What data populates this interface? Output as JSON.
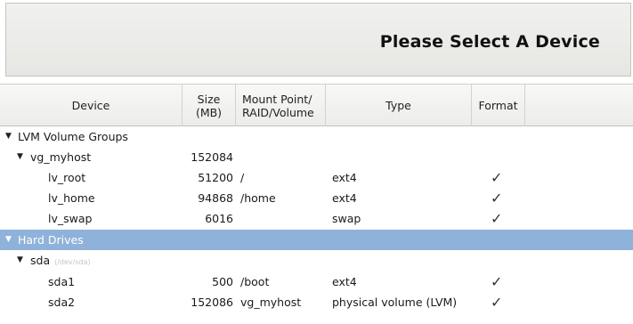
{
  "banner": {
    "title": "Please Select A Device"
  },
  "columns": {
    "device": "Device",
    "size": "Size\n(MB)",
    "mount": "Mount Point/\nRAID/Volume",
    "type": "Type",
    "format": "Format"
  },
  "rows": [
    {
      "name": "LVM Volume Groups",
      "size": "",
      "mount": "",
      "type": "",
      "format": ""
    },
    {
      "name": "vg_myhost",
      "size": "152084",
      "mount": "",
      "type": "",
      "format": ""
    },
    {
      "name": "lv_root",
      "size": "51200",
      "mount": "/",
      "type": "ext4",
      "format": "✓"
    },
    {
      "name": "lv_home",
      "size": "94868",
      "mount": "/home",
      "type": "ext4",
      "format": "✓"
    },
    {
      "name": "lv_swap",
      "size": "6016",
      "mount": "",
      "type": "swap",
      "format": "✓"
    },
    {
      "name": "Hard Drives",
      "size": "",
      "mount": "",
      "type": "",
      "format": ""
    },
    {
      "name": "sda",
      "path": "(/dev/sda)",
      "size": "",
      "mount": "",
      "type": "",
      "format": ""
    },
    {
      "name": "sda1",
      "size": "500",
      "mount": "/boot",
      "type": "ext4",
      "format": "✓"
    },
    {
      "name": "sda2",
      "size": "152086",
      "mount": "vg_myhost",
      "type": "physical volume (LVM)",
      "format": "✓"
    }
  ],
  "icons": {
    "expander": "triangle-down-icon",
    "format": "checkmark-icon"
  },
  "colors": {
    "selected_row": "#8fb2da"
  }
}
